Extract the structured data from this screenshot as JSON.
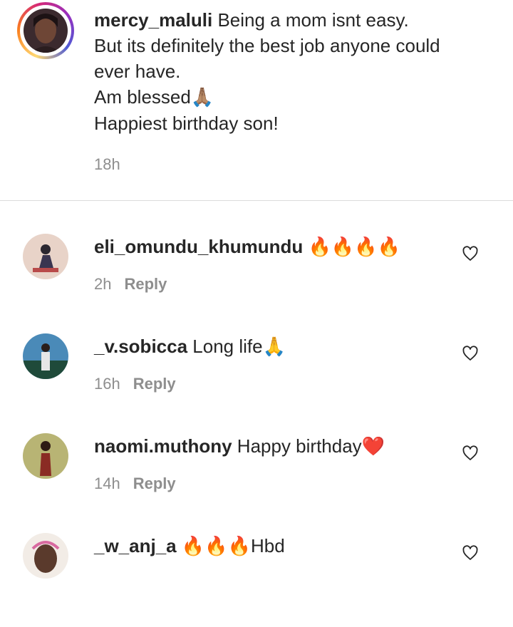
{
  "caption": {
    "username": "mercy_maluli",
    "lines": [
      "Being a mom isnt easy.",
      "But its definitely the best job anyone could",
      "ever have.",
      "Am blessed",
      "Happiest birthday son!"
    ],
    "blessed_emoji": "🙏🏽",
    "time": "18h"
  },
  "comments": [
    {
      "username": "eli_omundu_khumundu",
      "text": "",
      "emoji": "🔥🔥🔥🔥",
      "time": "2h",
      "reply_label": "Reply"
    },
    {
      "username": "_v.sobicca",
      "text": "Long life",
      "emoji": "🙏",
      "time": "16h",
      "reply_label": "Reply"
    },
    {
      "username": "naomi.muthony",
      "text": "Happy birthday",
      "emoji": "❤️",
      "time": "14h",
      "reply_label": "Reply"
    },
    {
      "username": "_w_anj_a",
      "text": "Hbd",
      "emoji": "🔥🔥🔥",
      "time": "",
      "reply_label": ""
    }
  ],
  "icons": {
    "like": "heart-outline-icon"
  },
  "colors": {
    "text": "#262626",
    "muted": "#8e8e8e",
    "divider": "#dbdbdb"
  }
}
